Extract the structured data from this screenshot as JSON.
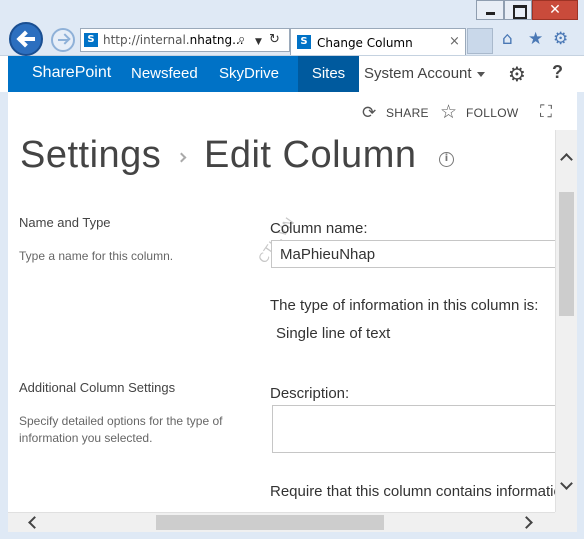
{
  "browser": {
    "address_prefix": "http://internal.",
    "address_host": "nhatng...",
    "tab_title": "Change Column",
    "tab_close": "×",
    "site_icon_letter": "S"
  },
  "suite_bar": {
    "brand": "SharePoint",
    "links": [
      "Newsfeed",
      "SkyDrive",
      "Sites"
    ],
    "selected_link": "Sites",
    "account": "System Account",
    "accent_color": "#0072c6",
    "selected_color": "#005a9e"
  },
  "actions": {
    "share": "SHARE",
    "follow": "FOLLOW"
  },
  "page": {
    "title": "Settings",
    "subtitle": "Edit Column",
    "watermark": "CTL.VN"
  },
  "sections": {
    "name_type": {
      "heading": "Name and Type",
      "description": "Type a name for this column.",
      "column_name_label": "Column name:",
      "column_name_value": "MaPhieuNhap",
      "type_label": "The type of information in this column is:",
      "type_value": "Single line of text"
    },
    "additional": {
      "heading": "Additional Column Settings",
      "description": "Specify detailed options for the type of information you selected.",
      "description_label": "Description:",
      "require_label": "Require that this column contains information:"
    }
  },
  "icons": [
    "back-icon",
    "forward-icon",
    "search-icon",
    "refresh-icon",
    "close-icon",
    "home-icon",
    "star-icon",
    "gear-icon",
    "help-icon",
    "share-icon",
    "follow-icon",
    "focus-icon",
    "info-icon"
  ]
}
